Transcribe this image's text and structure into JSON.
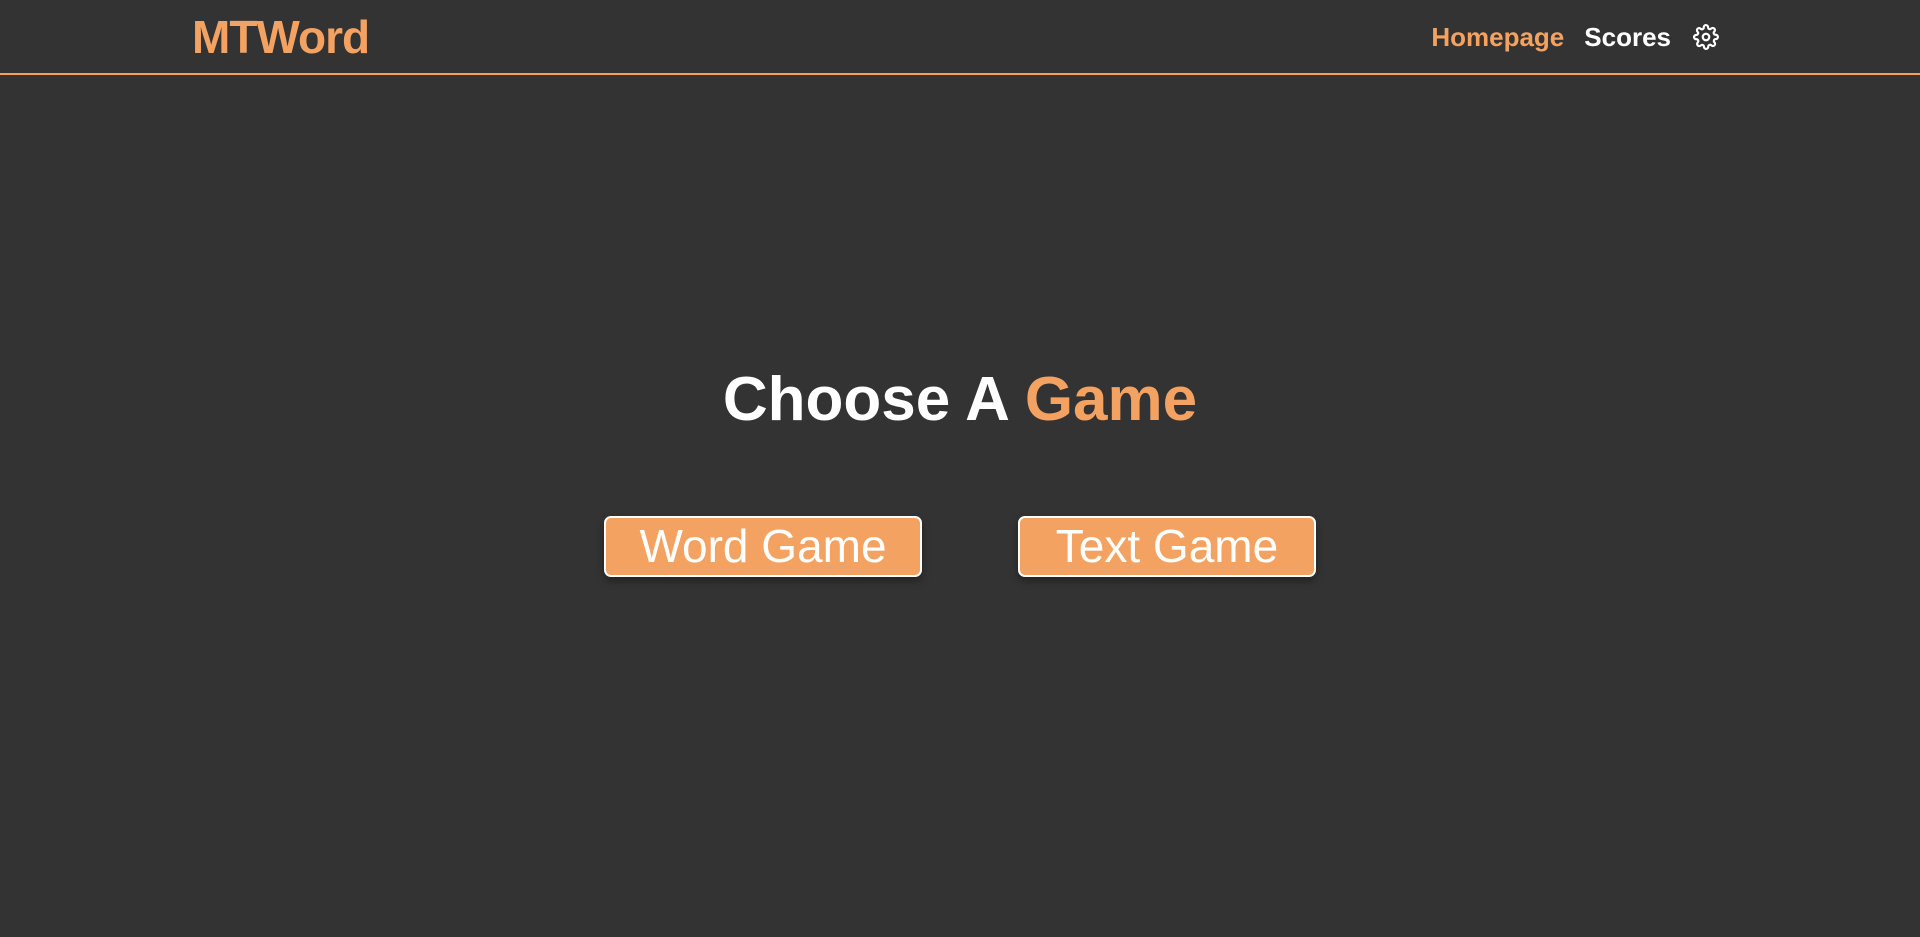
{
  "header": {
    "logo": "MTWord",
    "nav": {
      "homepage": "Homepage",
      "scores": "Scores",
      "settings_icon": "gear-icon"
    }
  },
  "main": {
    "heading_prefix": "Choose A",
    "heading_accent": "Game",
    "buttons": {
      "word_game": "Word Game",
      "text_game": "Text Game"
    }
  },
  "colors": {
    "background": "#333333",
    "accent": "#f4a261",
    "text": "#ffffff"
  }
}
